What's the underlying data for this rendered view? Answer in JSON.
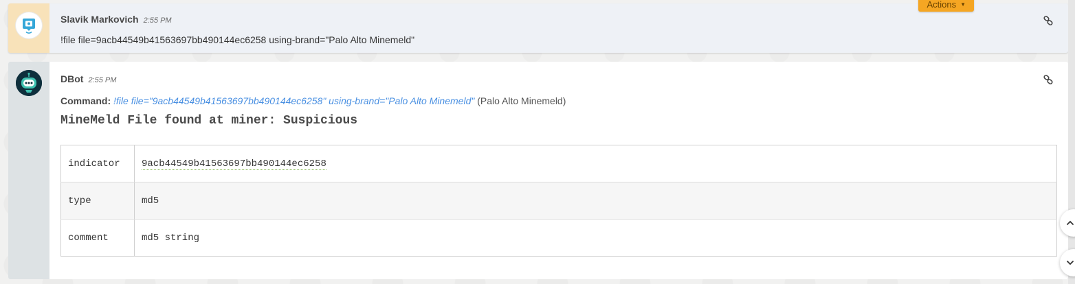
{
  "user_message": {
    "author": "Slavik Markovich",
    "time": "2:55 PM",
    "text": "!file file=9acb44549b41563697bb490144ec6258 using-brand=\"Palo Alto Minemeld\"",
    "actions_label": "Actions"
  },
  "bot_message": {
    "author": "DBot",
    "time": "2:55 PM",
    "command_label": "Command:",
    "command_text": "!file file=\"9acb44549b41563697bb490144ec6258\" using-brand=\"Palo Alto Minemeld\"",
    "command_brand": "(Palo Alto Minemeld)",
    "result_title": "MineMeld File found at miner: Suspicious",
    "table": [
      {
        "key": "indicator",
        "value": "9acb44549b41563697bb490144ec6258"
      },
      {
        "key": "type",
        "value": "md5"
      },
      {
        "key": "comment",
        "value": "md5 string"
      }
    ]
  },
  "icons": {
    "user_avatar": "chat-bubble-user-icon",
    "bot_avatar": "robot-icon",
    "permalink": "link-icon",
    "actions_caret": "caret-down-icon",
    "scroll_up": "chevron-up-icon",
    "scroll_down": "chevron-down-icon"
  },
  "colors": {
    "accent": "#f5a623",
    "link": "#4a90e2",
    "user_gutter": "#f8e2b9",
    "bot_gutter": "#dde2e4",
    "bot_avatar_bg": "#0e2f3c",
    "bot_face": "#3fc1b0"
  }
}
